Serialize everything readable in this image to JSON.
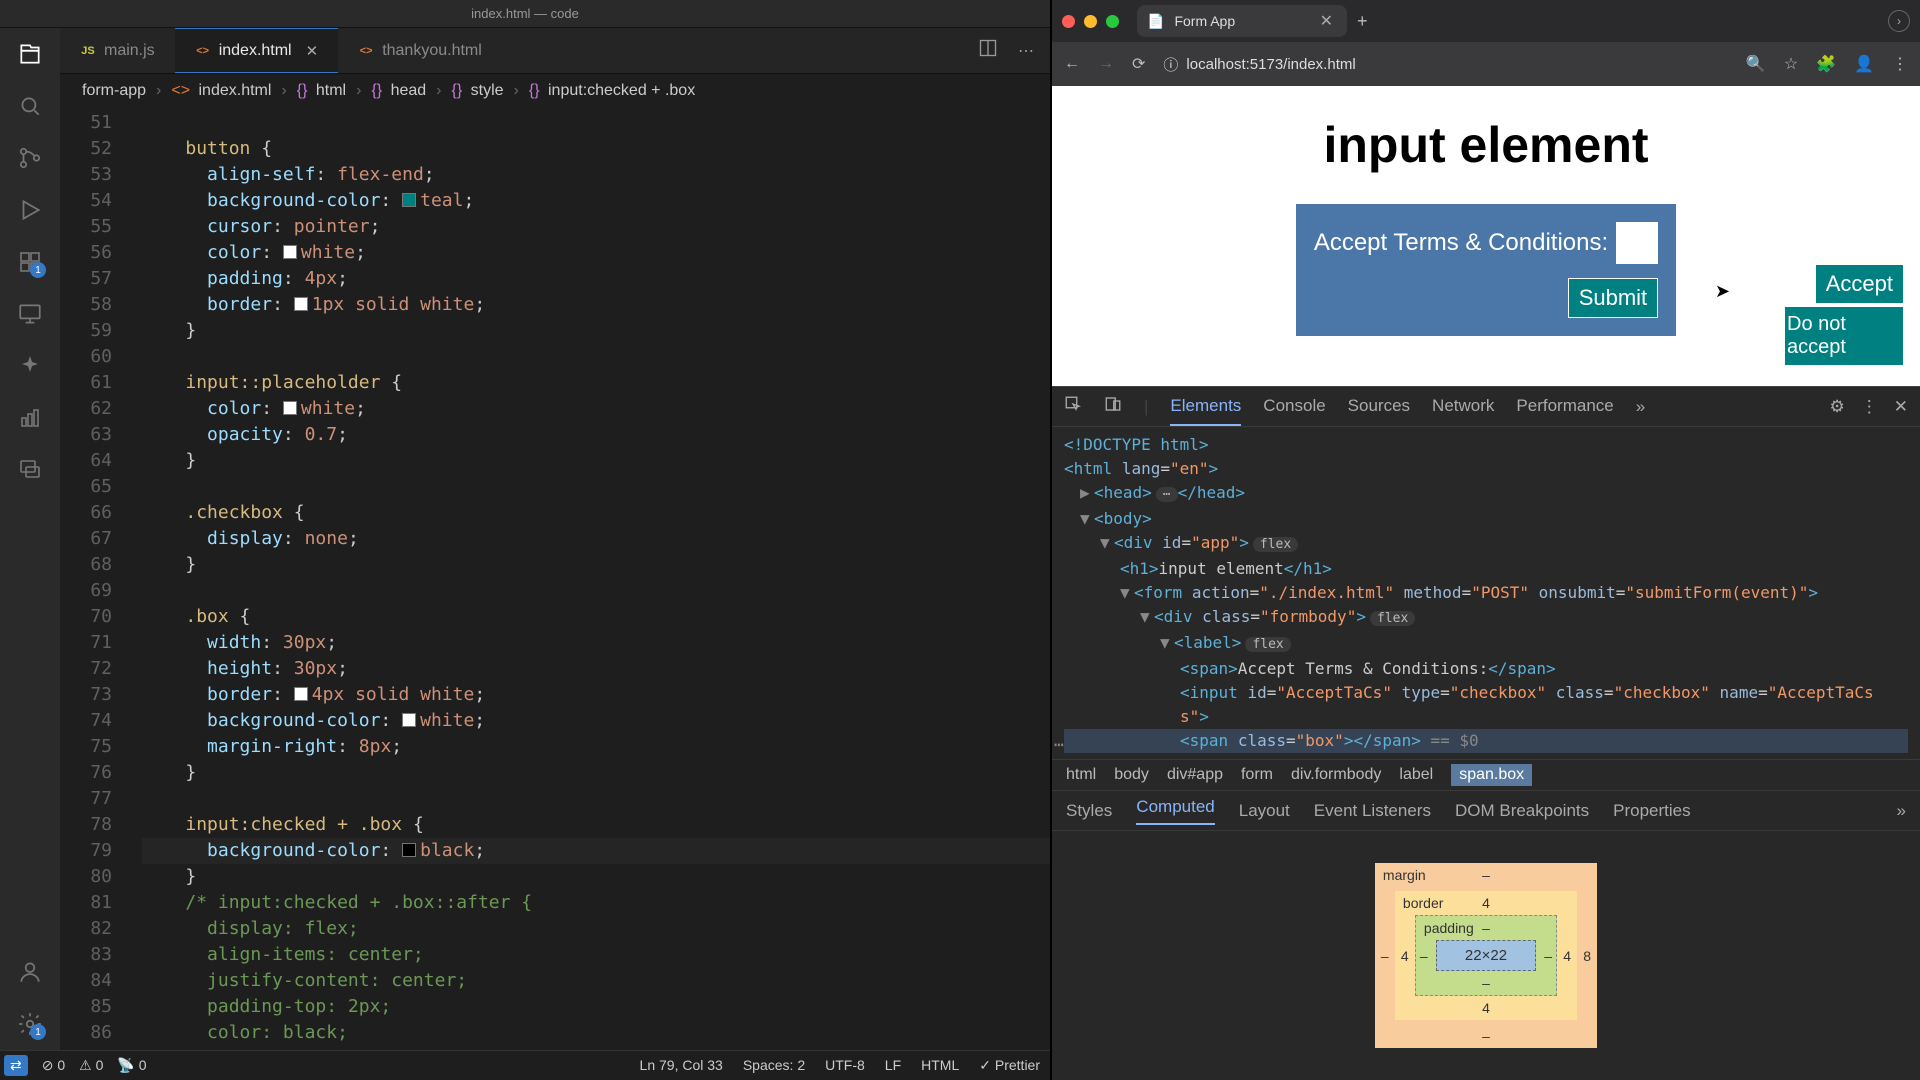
{
  "vscode": {
    "title": "index.html — code",
    "sidebar_badge_ext": "1",
    "sidebar_badge_gear": "1",
    "tabs": [
      {
        "icon": "JS",
        "iconColor": "#cbcb41",
        "label": "main.js"
      },
      {
        "icon": "<>",
        "iconColor": "#e37933",
        "label": "index.html",
        "active": true
      },
      {
        "icon": "<>",
        "iconColor": "#e37933",
        "label": "thankyou.html"
      }
    ],
    "breadcrumbs": [
      "form-app",
      "index.html",
      "html",
      "head",
      "style",
      "input:checked + .box"
    ],
    "code_start_line": 51,
    "code": [
      {
        "t": "",
        "i": 2
      },
      {
        "t": "button {",
        "i": 2,
        "cls": "sel"
      },
      {
        "t": "align-self: flex-end;",
        "i": 3,
        "kind": "decl",
        "prop": "align-self",
        "val": "flex-end"
      },
      {
        "t": "background-color: teal;",
        "i": 3,
        "kind": "decl",
        "prop": "background-color",
        "val": "teal",
        "sw": "#008080"
      },
      {
        "t": "cursor: pointer;",
        "i": 3,
        "kind": "decl",
        "prop": "cursor",
        "val": "pointer"
      },
      {
        "t": "color: white;",
        "i": 3,
        "kind": "decl",
        "prop": "color",
        "val": "white",
        "sw": "#ffffff"
      },
      {
        "t": "padding: 4px;",
        "i": 3,
        "kind": "decl",
        "prop": "padding",
        "val": "4px"
      },
      {
        "t": "border: 1px solid white;",
        "i": 3,
        "kind": "decl",
        "prop": "border",
        "val": "1px solid white",
        "sw": "#ffffff"
      },
      {
        "t": "}",
        "i": 2
      },
      {
        "t": "",
        "i": 2
      },
      {
        "t": "input::placeholder {",
        "i": 2,
        "cls": "sel"
      },
      {
        "t": "color: white;",
        "i": 3,
        "kind": "decl",
        "prop": "color",
        "val": "white",
        "sw": "#ffffff"
      },
      {
        "t": "opacity: 0.7;",
        "i": 3,
        "kind": "decl",
        "prop": "opacity",
        "val": "0.7"
      },
      {
        "t": "}",
        "i": 2
      },
      {
        "t": "",
        "i": 2
      },
      {
        "t": ".checkbox {",
        "i": 2,
        "cls": "sel"
      },
      {
        "t": "display: none;",
        "i": 3,
        "kind": "decl",
        "prop": "display",
        "val": "none"
      },
      {
        "t": "}",
        "i": 2
      },
      {
        "t": "",
        "i": 2
      },
      {
        "t": ".box {",
        "i": 2,
        "cls": "sel"
      },
      {
        "t": "width: 30px;",
        "i": 3,
        "kind": "decl",
        "prop": "width",
        "val": "30px"
      },
      {
        "t": "height: 30px;",
        "i": 3,
        "kind": "decl",
        "prop": "height",
        "val": "30px"
      },
      {
        "t": "border: 4px solid white;",
        "i": 3,
        "kind": "decl",
        "prop": "border",
        "val": "4px solid white",
        "sw": "#ffffff"
      },
      {
        "t": "background-color: white;",
        "i": 3,
        "kind": "decl",
        "prop": "background-color",
        "val": "white",
        "sw": "#ffffff"
      },
      {
        "t": "margin-right: 8px;",
        "i": 3,
        "kind": "decl",
        "prop": "margin-right",
        "val": "8px"
      },
      {
        "t": "}",
        "i": 2
      },
      {
        "t": "",
        "i": 2
      },
      {
        "t": "input:checked + .box {",
        "i": 2,
        "cls": "sel"
      },
      {
        "t": "background-color: black;",
        "i": 3,
        "kind": "decl",
        "prop": "background-color",
        "val": "black",
        "sw": "#000000",
        "cursor": true
      },
      {
        "t": "}",
        "i": 2
      },
      {
        "t": "/* input:checked + .box::after {",
        "i": 2,
        "cls": "com"
      },
      {
        "t": "display: flex;",
        "i": 3,
        "cls": "com"
      },
      {
        "t": "align-items: center;",
        "i": 3,
        "cls": "com"
      },
      {
        "t": "justify-content: center;",
        "i": 3,
        "cls": "com"
      },
      {
        "t": "padding-top: 2px;",
        "i": 3,
        "cls": "com"
      },
      {
        "t": "color: black;",
        "i": 3,
        "cls": "com"
      }
    ],
    "status": {
      "errors": "0",
      "warnings": "0",
      "ports": "0",
      "cursor": "Ln 79, Col 33",
      "spaces": "Spaces: 2",
      "enc": "UTF-8",
      "eol": "LF",
      "lang": "HTML",
      "fmt": "Prettier"
    }
  },
  "browser": {
    "tab_title": "Form App",
    "url": "localhost:5173/index.html",
    "page": {
      "heading": "input element",
      "label": "Accept Terms & Conditions:",
      "submit": "Submit",
      "accept": "Accept",
      "reject": "Do not accept"
    },
    "devtools": {
      "tabs": [
        "Elements",
        "Console",
        "Sources",
        "Network",
        "Performance"
      ],
      "active_tab": "Elements",
      "doctype": "<!DOCTYPE html>",
      "html_lang": "en",
      "h1_text": "input element",
      "form_action": "./index.html",
      "form_method": "POST",
      "form_onsubmit": "submitForm(event)",
      "formbody_class": "formbody",
      "span_text": "Accept Terms & Conditions:",
      "input_id": "AcceptTaCs",
      "input_type": "checkbox",
      "input_class": "checkbox",
      "input_name": "AcceptTaCs",
      "boxspan_class": "box",
      "eq0": "== $0",
      "crumbs": [
        "html",
        "body",
        "div#app",
        "form",
        "div.formbody",
        "label",
        "span.box"
      ],
      "style_tabs": [
        "Styles",
        "Computed",
        "Layout",
        "Event Listeners",
        "DOM Breakpoints",
        "Properties"
      ],
      "style_active": "Computed",
      "boxmodel": {
        "margin": {
          "top": "–",
          "right": "8",
          "bottom": "–",
          "left": "–"
        },
        "border": {
          "top": "4",
          "right": "4",
          "bottom": "4",
          "left": "4"
        },
        "padding": {
          "top": "–",
          "right": "–",
          "bottom": "–",
          "left": "–"
        },
        "content": "22×22"
      }
    }
  }
}
